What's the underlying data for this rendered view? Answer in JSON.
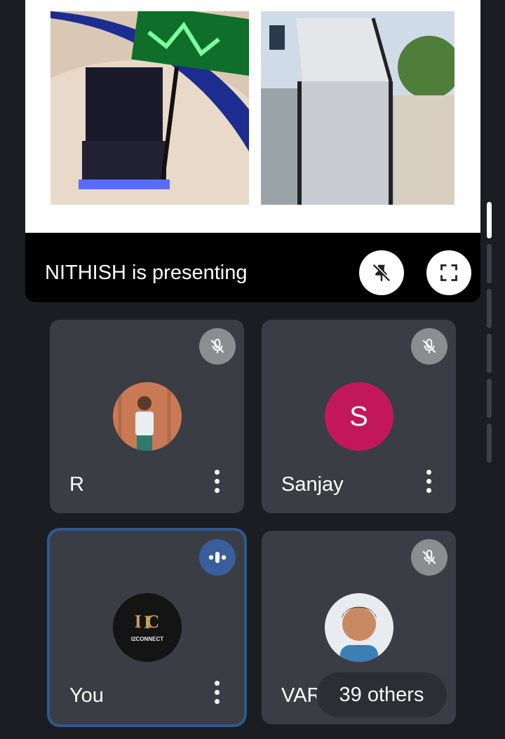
{
  "presentation": {
    "presenter_text": "NITHISH is presenting",
    "unpin_icon": "unpin-icon",
    "fullscreen_icon": "fullscreen-icon"
  },
  "participants": [
    {
      "name": "R",
      "status": "muted",
      "avatar": "photo"
    },
    {
      "name": "Sanjay",
      "status": "muted",
      "avatar_letter": "S",
      "avatar_color": "#c2185b"
    },
    {
      "name": "You",
      "status": "speaking",
      "avatar": "logo",
      "logo_text": "I C",
      "logo_subtitle": "I2CONNECT"
    },
    {
      "name": "VAR",
      "status": "muted",
      "avatar": "photo"
    }
  ],
  "others_pill": "39 others",
  "colors": {
    "background": "#1b1d22",
    "tile": "#3a3d43",
    "active_border": "#2c5a91",
    "mute_badge": "#8b8d90",
    "speak_badge": "#3a5e9c"
  }
}
